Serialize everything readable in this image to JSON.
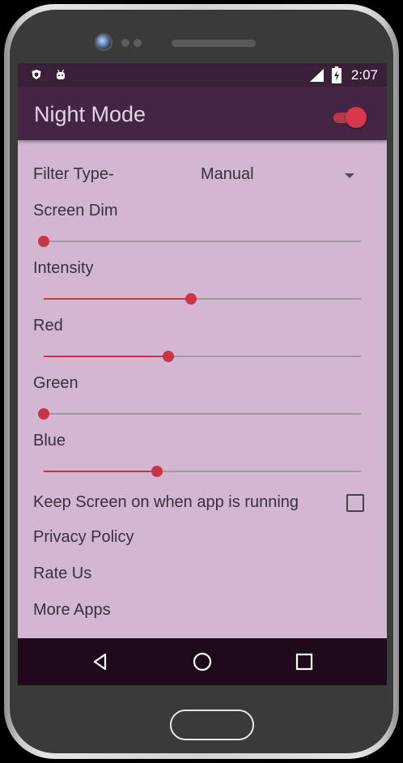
{
  "statusbar": {
    "time": "2:07",
    "icons": [
      "brave-shield-icon",
      "android-robot-icon",
      "signal-icon",
      "battery-charging-icon"
    ]
  },
  "appbar": {
    "title": "Night Mode",
    "night_mode_enabled": true
  },
  "settings": {
    "filter_type": {
      "label": "Filter Type-",
      "value": "Manual"
    },
    "sliders": [
      {
        "label": "Screen Dim",
        "value": 0
      },
      {
        "label": "Intensity",
        "value": 0.465
      },
      {
        "label": "Red",
        "value": 0.393
      },
      {
        "label": "Green",
        "value": 0
      },
      {
        "label": "Blue",
        "value": 0.357
      }
    ],
    "keep_screen_on": {
      "label": "Keep Screen on when app is running",
      "checked": false
    },
    "links": [
      {
        "label": "Privacy Policy"
      },
      {
        "label": "Rate Us"
      },
      {
        "label": "More Apps"
      }
    ]
  },
  "navbar": {
    "buttons": [
      "back-icon",
      "home-icon",
      "recents-icon"
    ]
  },
  "colors": {
    "accent": "#cb3447",
    "background": "#d3b7d2",
    "appbar": "#452544",
    "statusbar": "#3a1f38",
    "navbar": "#1f0a1d"
  }
}
